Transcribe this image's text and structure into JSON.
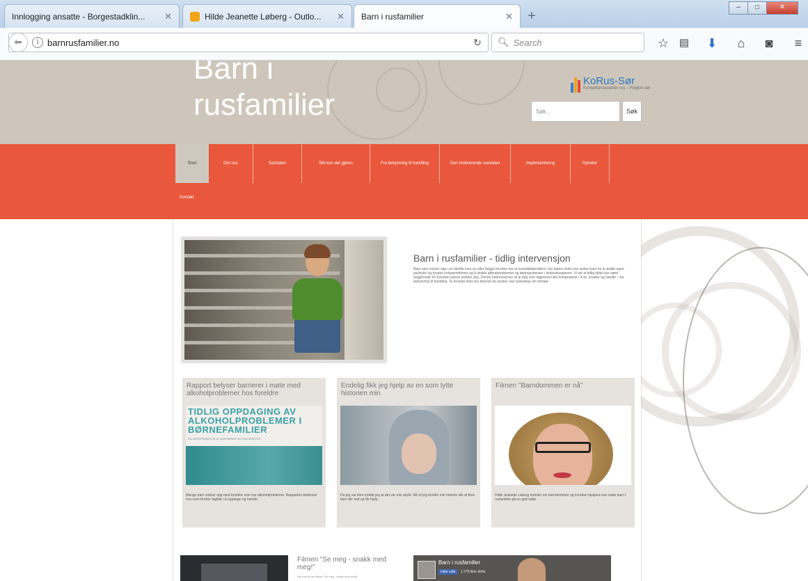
{
  "browser": {
    "tabs": [
      {
        "title": "Innlogging ansatte - Borgestadklin...",
        "active": false
      },
      {
        "title": "Hilde Jeanette Løberg - Outlo...",
        "active": false
      },
      {
        "title": "Barn i rusfamilier",
        "active": true
      }
    ],
    "url": "barnrusfamilier.no",
    "search_placeholder": "Search"
  },
  "site": {
    "title_line1": "Barn i",
    "title_line2": "rusfamilier",
    "logo_name": "KoRus-Sør",
    "logo_sub": "Kompetansesenter rus – Region sør",
    "search_placeholder": "Søk...",
    "search_button": "Søk"
  },
  "menu": {
    "items": [
      "Start",
      "Om oss",
      "Samtalen",
      "Slik kan det gjøres",
      "Fra bekymring til handling",
      "Den motiverende samtalen",
      "Implementering",
      "Nyheter"
    ],
    "second_row": "Kontakt"
  },
  "hero": {
    "title": "Barn i rusfamilier - tidlig intervensjon",
    "text": "Barn som vokser opp i en familie hvor en eller begge foreldre har et rusmiddelproblem, har større risiko enn andre barn for å utvikle egne psykiske og fysiske helseproblemer og å utvikle atferdsproblemer og læringsvansker i skolesituasjonen. Vi vet at tidlig hjelp kan være avgjørende for hvordan barnet utvikler seg. Denne nettressursen vil gi deg som fagperson økt kompetanse i å se, snakke og handle – fra bekymring til handling. Ta kontakt med oss dersom du ønsker mer kunnskap om temaet."
  },
  "cards": [
    {
      "title": "Rapport belyser barrierer i møte med alkoholproblemer hos foreldre",
      "report_heading": "TIDLIG OPPDAGING AV ALKOHOLPROBLEMER I BØRNEFAMILIER",
      "report_sub": "EN UNDERSØKELSE AV BARRIERER OG MULIGHETER",
      "text": "Mange barn vokser opp med foreldre som har alkoholproblemer. Rapporten beskriver hva som hindrer fagfolk i å oppdage og handle."
    },
    {
      "title": "Endelig fikk jeg hjelp av en som lytte historien min",
      "text": "Da jeg var liten trodde jeg at det var min skyld. Nå vil jeg fortelle min historie slik at flere barn blir sett og får hjelp."
    },
    {
      "title": "Filmen \"Barndommen er nå\"",
      "text": "Hilde Jeanette Løberg forteller om barndommen og hvordan hjelpere kan møte barn i rusfamilier på en god måte."
    }
  ],
  "bottom": {
    "video_title": "Filmen \"Se meg - snakk med meg!\"",
    "video_text": "Her kan du se filmen \"Se meg - snakk med meg!\"",
    "fb_name": "Barn i rusfamilier",
    "fb_like": "Liker side",
    "fb_count": "1 278 liker dette"
  }
}
